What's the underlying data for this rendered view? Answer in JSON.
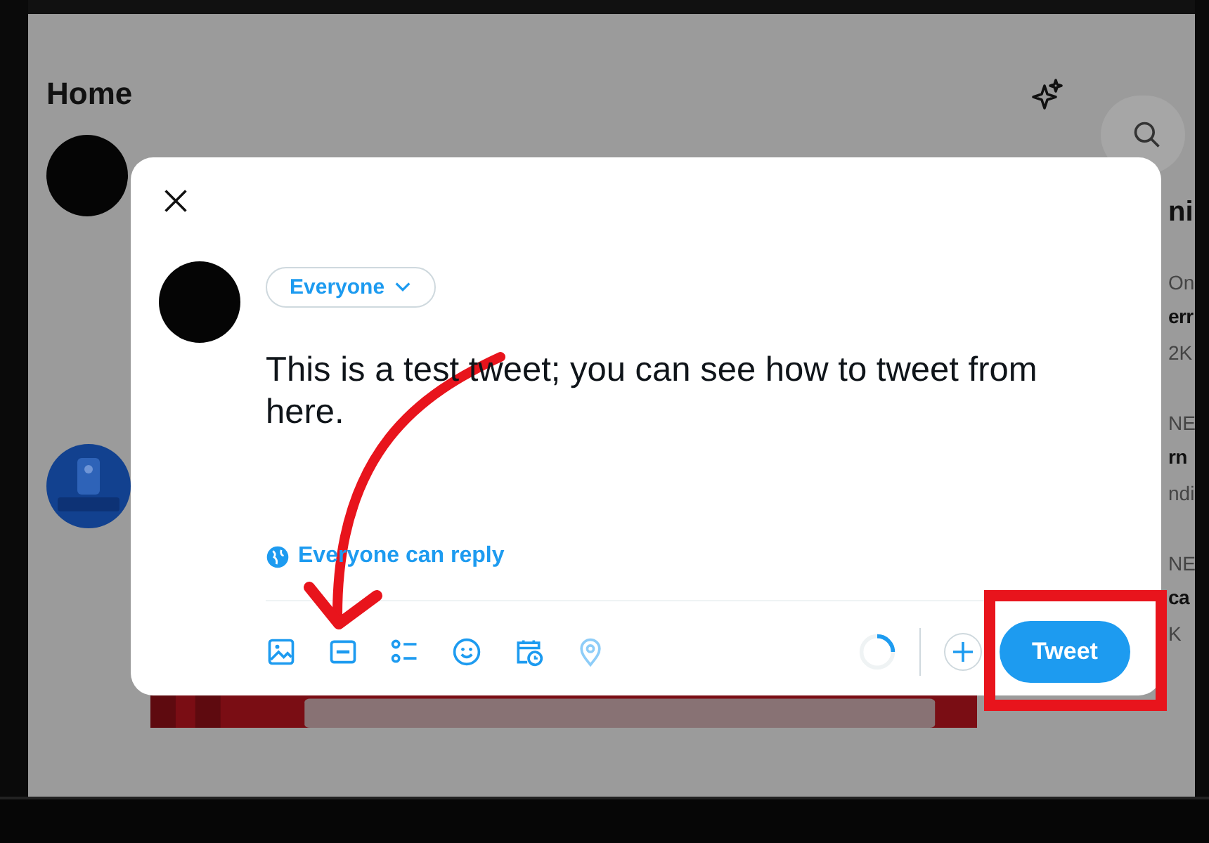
{
  "header": {
    "title": "Home"
  },
  "side_column": [
    {
      "text": "ni",
      "kind": "heading"
    },
    {
      "text": "On",
      "kind": "meta"
    },
    {
      "text": "err",
      "kind": "title"
    },
    {
      "text": "2K",
      "kind": "meta"
    },
    {
      "text": "NE",
      "kind": "meta"
    },
    {
      "text": "rn",
      "kind": "title"
    },
    {
      "text": "ndi",
      "kind": "meta"
    },
    {
      "text": "NE",
      "kind": "meta"
    },
    {
      "text": "ca",
      "kind": "title"
    },
    {
      "text": "K",
      "kind": "meta"
    }
  ],
  "composer": {
    "audience": "Everyone",
    "text": "This is a test tweet; you can see how to tweet from here.",
    "reply_setting": "Everyone can reply",
    "button": "Tweet"
  }
}
